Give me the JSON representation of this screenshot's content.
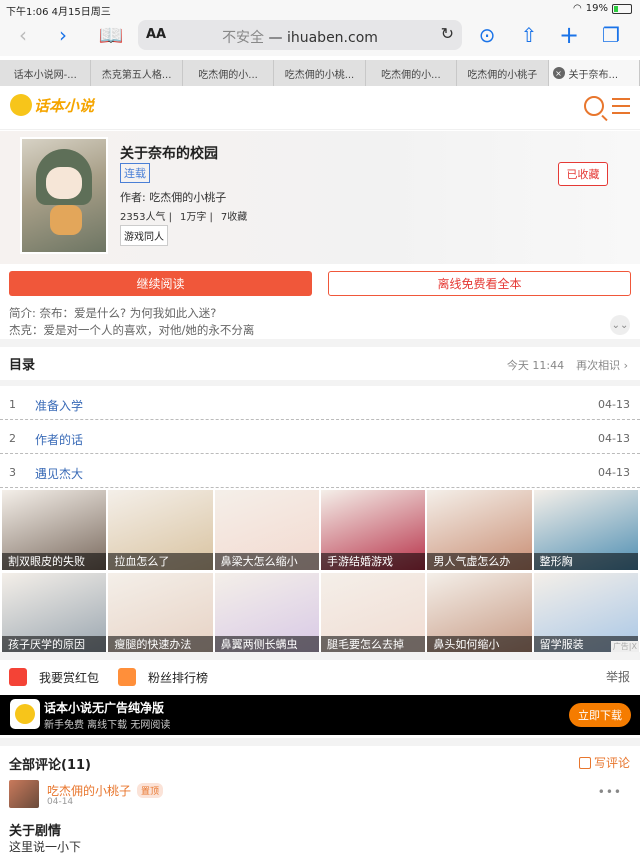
{
  "status": {
    "time": "下午1:06  4月15日周三",
    "battery": "19%"
  },
  "browser": {
    "aa": "AA",
    "security": "不安全",
    "domain": "ihuaben.com"
  },
  "tabs": [
    {
      "label": "话本小说网-...",
      "active": false
    },
    {
      "label": "杰克第五人格...",
      "active": false
    },
    {
      "label": "吃杰佣的小...",
      "active": false
    },
    {
      "label": "吃杰佣的小桃...",
      "active": false
    },
    {
      "label": "吃杰佣的小...",
      "active": false
    },
    {
      "label": "吃杰佣的小桃子",
      "active": false
    },
    {
      "label": "关于奈布...",
      "active": true
    }
  ],
  "site": {
    "logo": "话本小说"
  },
  "book": {
    "title": "关于奈布的校园",
    "status": "连载",
    "author_label": "作者: ",
    "author": "吃杰佣的小桃子",
    "popularity": "2353人气 |",
    "words": "1万字 |",
    "favorites": "7收藏",
    "genre": "游戏同人",
    "faved_label": "已收藏",
    "intro_line1": "简介: 奈布：爱是什么? 为何我如此入迷?",
    "intro_line2": "杰克：爱是对一个人的喜欢，对他/她的永不分离"
  },
  "actions": {
    "continue": "继续阅读",
    "offline": "离线免费看全本"
  },
  "toc": {
    "title": "目录",
    "updated": "今天 11:44",
    "resume": "再次相识",
    "chapters": [
      {
        "num": "1",
        "name": "准备入学",
        "date": "04-13"
      },
      {
        "num": "2",
        "name": "作者的话",
        "date": "04-13"
      },
      {
        "num": "3",
        "name": "遇见杰大",
        "date": "04-13"
      }
    ]
  },
  "ads": {
    "close_label": "广告|X",
    "items": [
      {
        "caption": "割双眼皮的失败",
        "color": "#7a6a5e"
      },
      {
        "caption": "拉血怎么了",
        "color": "#d9c3a0"
      },
      {
        "caption": "鼻梁大怎么缩小",
        "color": "#f3d9cf"
      },
      {
        "caption": "手游结婚游戏",
        "color": "#b8334a"
      },
      {
        "caption": "男人气虚怎么办",
        "color": "#c98e74"
      },
      {
        "caption": "整形胸",
        "color": "#4f8fb3"
      },
      {
        "caption": "孩子厌学的原因",
        "color": "#9aa6b0"
      },
      {
        "caption": "瘦腿的快速办法",
        "color": "#e7d2c4"
      },
      {
        "caption": "鼻翼两侧长螨虫",
        "color": "#d8c9e6"
      },
      {
        "caption": "腿毛要怎么去掉",
        "color": "#f1dcd2"
      },
      {
        "caption": "鼻头如何缩小",
        "color": "#c79a84"
      },
      {
        "caption": "留学服装",
        "color": "#a9c7e6"
      }
    ]
  },
  "misc": {
    "reward": "我要赏红包",
    "ranking": "粉丝排行榜",
    "report": "举报"
  },
  "banner": {
    "title": "话本小说无广告纯净版",
    "subtitle": "新手免费 离线下载 无网阅读",
    "button": "立即下载"
  },
  "comments": {
    "title": "全部评论(11)",
    "write": "写评论",
    "first": {
      "user": "吃杰佣的小桃子",
      "badge": "置顶",
      "date": "04-14",
      "title": "关于剧情",
      "body": "这里说一小下"
    }
  }
}
